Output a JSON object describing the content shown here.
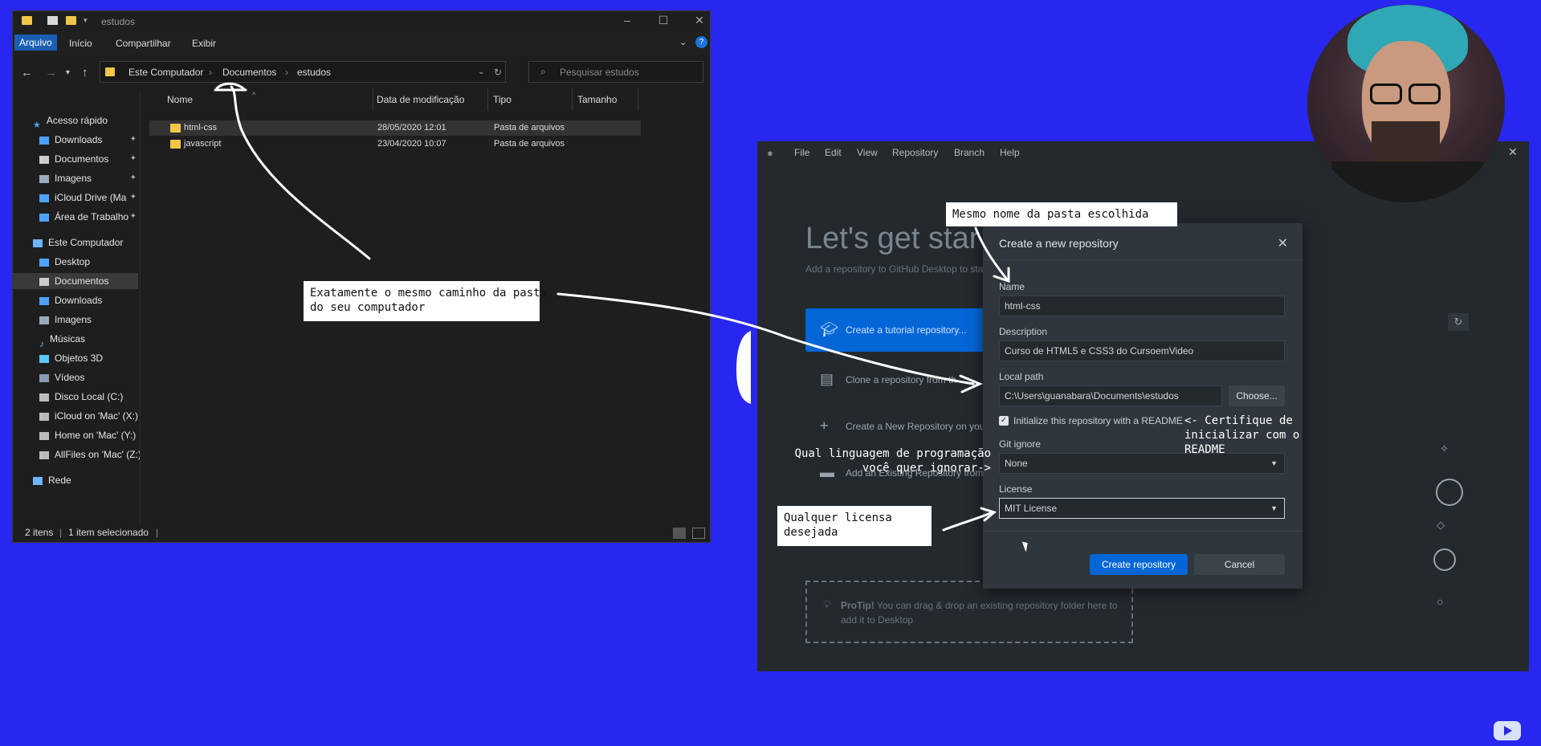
{
  "explorer": {
    "title": "estudos",
    "ribbon_tabs": [
      "Arquivo",
      "Início",
      "Compartilhar",
      "Exibir"
    ],
    "address": {
      "crumbs": [
        "Este Computador",
        "Documentos",
        "estudos"
      ]
    },
    "search_placeholder": "Pesquisar estudos",
    "nav": {
      "quick_access": "Acesso rápido",
      "quick_items": [
        "Downloads",
        "Documentos",
        "Imagens",
        "iCloud Drive (Ma",
        "Área de Trabalho"
      ],
      "this_pc": "Este Computador",
      "pc_items": [
        "Desktop",
        "Documentos",
        "Downloads",
        "Imagens",
        "Músicas",
        "Objetos 3D",
        "Vídeos",
        "Disco Local (C:)",
        "iCloud on 'Mac' (X:)",
        "Home on 'Mac' (Y:)",
        "AllFiles on 'Mac' (Z:)"
      ],
      "network": "Rede"
    },
    "columns": [
      "Nome",
      "Data de modificação",
      "Tipo",
      "Tamanho"
    ],
    "files": [
      {
        "name": "html-css",
        "date": "28/05/2020 12:01",
        "type": "Pasta de arquivos"
      },
      {
        "name": "javascript",
        "date": "23/04/2020 10:07",
        "type": "Pasta de arquivos"
      }
    ],
    "status": {
      "count": "2 itens",
      "selected": "1 item selecionado"
    }
  },
  "github": {
    "menu": [
      "File",
      "Edit",
      "View",
      "Repository",
      "Branch",
      "Help"
    ],
    "heading": "Let's get star",
    "subheading": "Add a repository to GitHub Desktop to sta",
    "options": [
      "Create a tutorial repository...",
      "Clone a repository from th",
      "Create a New Repository on you",
      "Add an Existing Repository from"
    ],
    "protip_bold": "ProTip!",
    "protip_text": " You can drag & drop an existing repository folder here to",
    "protip_text2": "add it to Desktop"
  },
  "dialog": {
    "title": "Create a new repository",
    "name_label": "Name",
    "name_value": "html-css",
    "description_label": "Description",
    "description_value": "Curso de HTML5 e CSS3 do CursoemVideo",
    "local_path_label": "Local path",
    "local_path_value": "C:\\Users\\guanabara\\Documents\\estudos",
    "choose_label": "Choose...",
    "readme_label": "Initialize this repository with a README",
    "gitignore_label": "Git ignore",
    "gitignore_value": "None",
    "license_label": "License",
    "license_value": "MIT License",
    "create_label": "Create repository",
    "cancel_label": "Cancel"
  },
  "annotations": {
    "same_name": "Mesmo nome da pasta escolhida",
    "same_path": "Exatamente o mesmo caminho da pasta\ndo seu computador",
    "readme": "<- Certifique de\ninicializar com o\nREADME",
    "gitignore": "Qual linguagem de programação\nvocê quer ignorar->",
    "license": "Qualquer licensa\ndesejada"
  },
  "colors": {
    "background": "#2727f0",
    "primary_button": "#0366d6",
    "folder": "#f0c54a"
  }
}
